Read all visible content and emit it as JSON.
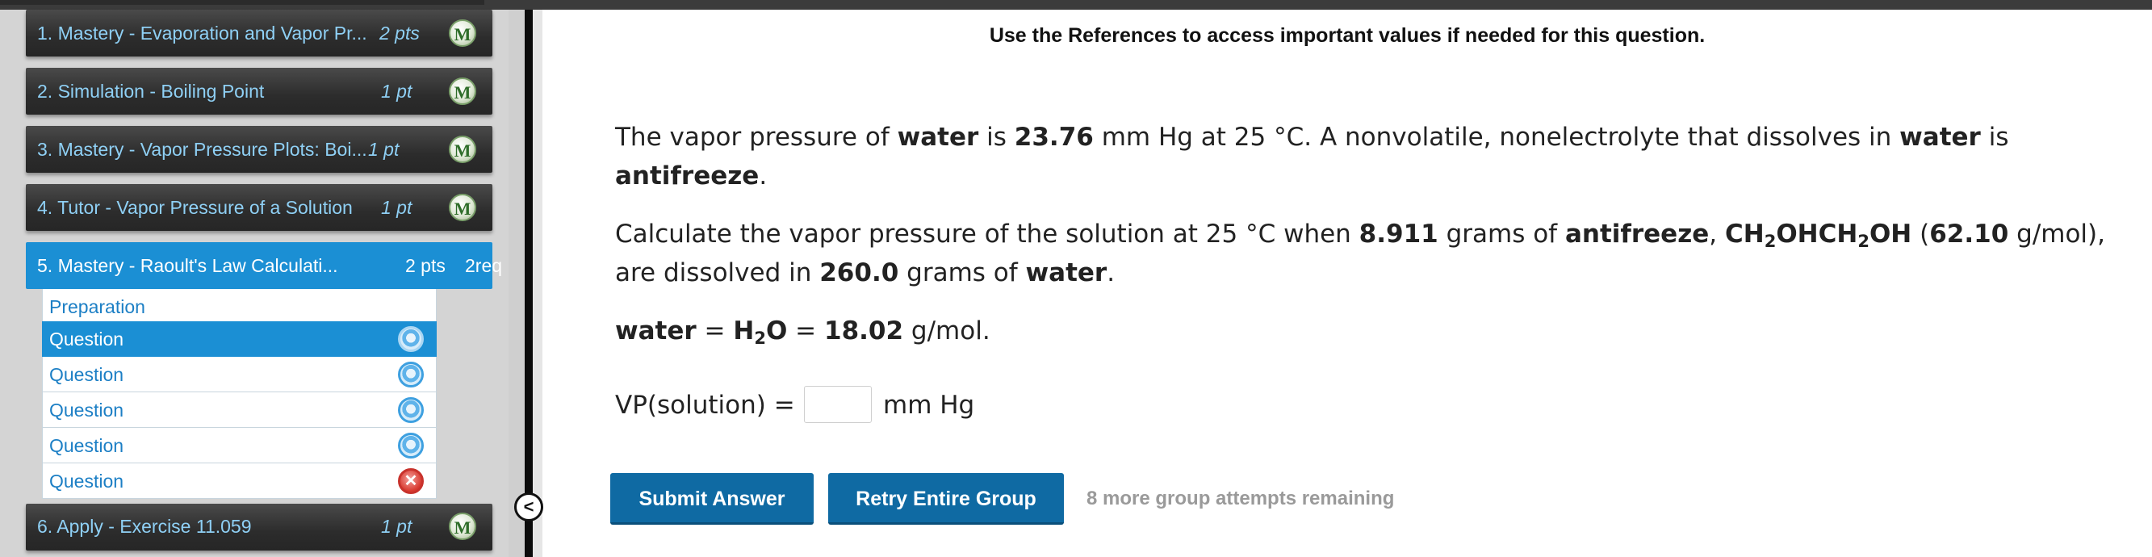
{
  "nav": {
    "items": [
      {
        "label": "1. Mastery - Evaporation and Vapor Pr...",
        "points": "2 pts",
        "badge": "M"
      },
      {
        "label": "2. Simulation - Boiling Point",
        "points": "1 pt",
        "badge": "M"
      },
      {
        "label": "3. Mastery - Vapor Pressure Plots: Boi...",
        "points": "1 pt",
        "badge": "M"
      },
      {
        "label": "4. Tutor - Vapor Pressure of a Solution",
        "points": "1 pt",
        "badge": "M"
      },
      {
        "label": "5. Mastery - Raoult's Law Calculati...",
        "points": "2 pts",
        "req": "2req"
      },
      {
        "label": "6. Apply - Exercise 11.059",
        "points": "1 pt",
        "badge": "M"
      }
    ],
    "subitems": [
      {
        "label": "Preparation"
      },
      {
        "label": "Question",
        "status": "in-progress-icon"
      },
      {
        "label": "Question",
        "status": "in-progress-icon"
      },
      {
        "label": "Question",
        "status": "in-progress-icon"
      },
      {
        "label": "Question",
        "status": "in-progress-icon"
      },
      {
        "label": "Question",
        "status": "incorrect-icon"
      }
    ],
    "collapse_glyph": "<"
  },
  "main": {
    "reference_note": "Use the References to access important values if needed for this question.",
    "p1": {
      "t1": "The vapor pressure of ",
      "solvent": "water",
      "t2": " is ",
      "vp": "23.76",
      "t3": " mm Hg at 25 °C. A nonvolatile, nonelectrolyte that dissolves in ",
      "solvent2": "water",
      "t4": " is",
      "solute": "antifreeze",
      "t5": "."
    },
    "p2": {
      "t1": "Calculate the vapor pressure of the solution at 25 °C when ",
      "mass": "8.911",
      "t2": " grams of ",
      "solute": "antifreeze",
      "t3": ", ",
      "f1": "CH",
      "f1s": "2",
      "f2": "OHCH",
      "f2s": "2",
      "f3": "OH",
      "t4": " (",
      "mm": "62.10",
      "t5": " g/mol),",
      "t6": "are dissolved in ",
      "mass2": "260.0",
      "t7": " grams of ",
      "solvent": "water",
      "t8": "."
    },
    "p3": {
      "solvent": "water",
      "eq1": " = ",
      "h": "H",
      "hs": "2",
      "o": "O",
      "eq2": " = ",
      "mm": "18.02",
      "unit": " g/mol."
    },
    "answer": {
      "label": "VP(solution) = ",
      "value": "",
      "unit": "mm Hg"
    },
    "buttons": {
      "submit": "Submit Answer",
      "retry": "Retry Entire Group"
    },
    "attempts": "8 more group attempts remaining"
  },
  "colors": {
    "accent": "#1b8fd4",
    "button": "#0f6aa3",
    "nav_bg": "#2c2c2c",
    "nav_text": "#8fd0f5"
  }
}
